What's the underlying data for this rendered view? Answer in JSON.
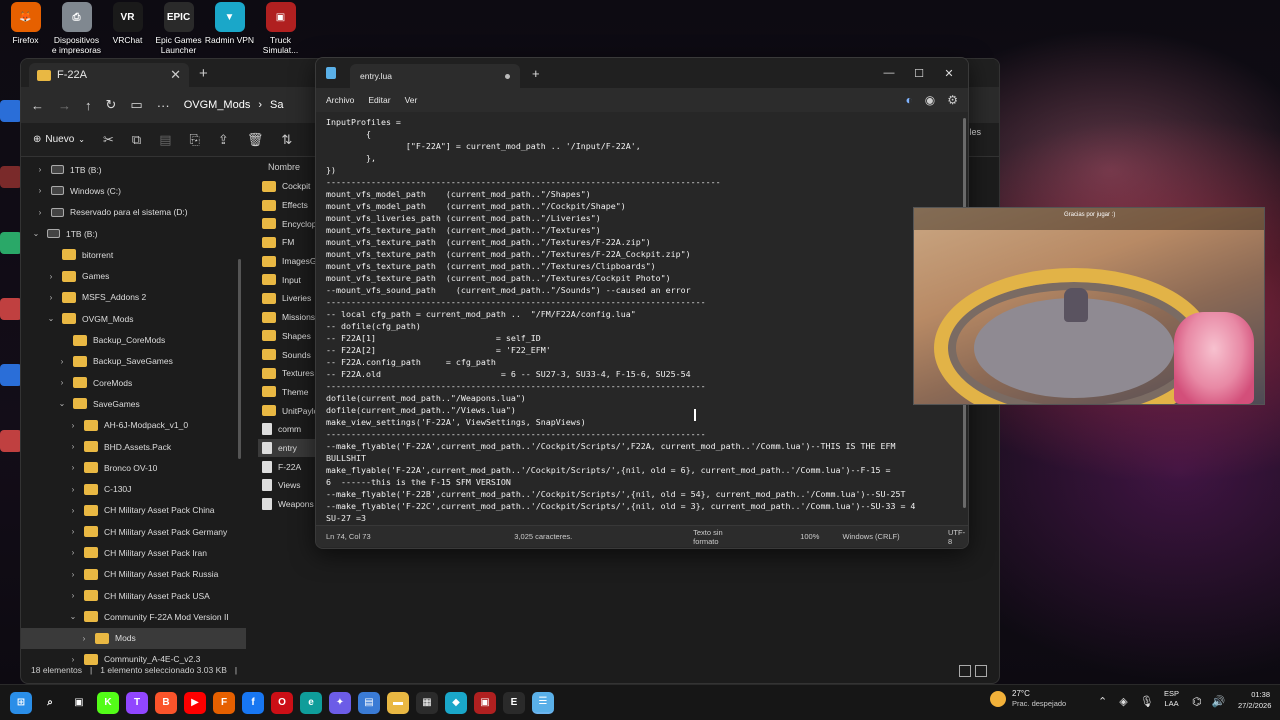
{
  "desktop_icons": [
    {
      "label": "Firefox",
      "color": "#e66000",
      "glyph": "🦊"
    },
    {
      "label": "Dispositivos e impresoras",
      "color": "#808890",
      "glyph": "⎙"
    },
    {
      "label": "VRChat",
      "color": "#1a1a1a",
      "glyph": "VR"
    },
    {
      "label": "Epic Games Launcher",
      "color": "#2a2a2a",
      "glyph": "EPIC"
    },
    {
      "label": "Radmin VPN",
      "color": "#1aa7c9",
      "glyph": "▼"
    },
    {
      "label": "Truck Simulat...",
      "color": "#b02020",
      "glyph": "▣"
    }
  ],
  "explorer": {
    "tab_title": "F-22A",
    "breadcrumb": [
      "OVGM_Mods",
      "Sa"
    ],
    "new_label": "Nuevo",
    "right_label": "talles",
    "tree": [
      {
        "label": "1TB (B:)",
        "type": "drive",
        "indent": 0,
        "chev": "›"
      },
      {
        "label": "Windows (C:)",
        "type": "drive",
        "indent": 0,
        "chev": "›"
      },
      {
        "label": "Reservado para el sistema (D:)",
        "type": "drive",
        "indent": 0,
        "chev": "›"
      },
      {
        "label": "1TB (B:)",
        "type": "drive",
        "indent": -1,
        "chev": "⌄"
      },
      {
        "label": "bitorrent",
        "type": "folder",
        "indent": 1,
        "chev": ""
      },
      {
        "label": "Games",
        "type": "folder",
        "indent": 1,
        "chev": "›"
      },
      {
        "label": "MSFS_Addons 2",
        "type": "folder",
        "indent": 1,
        "chev": "›"
      },
      {
        "label": "OVGM_Mods",
        "type": "folder",
        "indent": 1,
        "chev": "⌄"
      },
      {
        "label": "Backup_CoreMods",
        "type": "folder",
        "indent": 2,
        "chev": ""
      },
      {
        "label": "Backup_SaveGames",
        "type": "folder",
        "indent": 2,
        "chev": "›"
      },
      {
        "label": "CoreMods",
        "type": "folder",
        "indent": 2,
        "chev": "›"
      },
      {
        "label": "SaveGames",
        "type": "folder",
        "indent": 2,
        "chev": "⌄"
      },
      {
        "label": "AH-6J-Modpack_v1_0",
        "type": "folder",
        "indent": 3,
        "chev": "›"
      },
      {
        "label": "BHD.Assets.Pack",
        "type": "folder",
        "indent": 3,
        "chev": "›"
      },
      {
        "label": "Bronco OV-10",
        "type": "folder",
        "indent": 3,
        "chev": "›"
      },
      {
        "label": "C-130J",
        "type": "folder",
        "indent": 3,
        "chev": "›"
      },
      {
        "label": "CH Military Asset Pack China",
        "type": "folder",
        "indent": 3,
        "chev": "›"
      },
      {
        "label": "CH Military Asset Pack Germany",
        "type": "folder",
        "indent": 3,
        "chev": "›"
      },
      {
        "label": "CH Military Asset Pack Iran",
        "type": "folder",
        "indent": 3,
        "chev": "›"
      },
      {
        "label": "CH Military Asset Pack Russia",
        "type": "folder",
        "indent": 3,
        "chev": "›"
      },
      {
        "label": "CH Military Asset Pack USA",
        "type": "folder",
        "indent": 3,
        "chev": "›"
      },
      {
        "label": "Community F-22A Mod Version II",
        "type": "folder",
        "indent": 3,
        "chev": "⌄"
      },
      {
        "label": "Mods",
        "type": "folder",
        "indent": 4,
        "chev": "›",
        "selected": true
      },
      {
        "label": "Community_A-4E-C_v2.3",
        "type": "folder",
        "indent": 3,
        "chev": "›"
      }
    ],
    "files_header": "Nombre",
    "files": [
      {
        "label": "Cockpit",
        "type": "folder"
      },
      {
        "label": "Effects",
        "type": "folder"
      },
      {
        "label": "Encyclopedi",
        "type": "folder"
      },
      {
        "label": "FM",
        "type": "folder"
      },
      {
        "label": "ImagesGUI",
        "type": "folder"
      },
      {
        "label": "Input",
        "type": "folder"
      },
      {
        "label": "Liveries",
        "type": "folder"
      },
      {
        "label": "Missions",
        "type": "folder"
      },
      {
        "label": "Shapes",
        "type": "folder"
      },
      {
        "label": "Sounds",
        "type": "folder"
      },
      {
        "label": "Textures",
        "type": "folder"
      },
      {
        "label": "Theme",
        "type": "folder"
      },
      {
        "label": "UnitPayloads",
        "type": "folder"
      },
      {
        "label": "comm",
        "type": "file"
      },
      {
        "label": "entry",
        "type": "file",
        "selected": true
      },
      {
        "label": "F-22A",
        "type": "file"
      },
      {
        "label": "Views",
        "type": "file"
      },
      {
        "label": "Weapons",
        "type": "file"
      }
    ],
    "status_items": "18 elementos",
    "status_selected": "1 elemento seleccionado  3.03 KB"
  },
  "notepad": {
    "tab_title": "entry.lua",
    "menu": [
      "Archivo",
      "Editar",
      "Ver"
    ],
    "lines": [
      "InputProfiles =",
      "        {",
      "                [\"F-22A\"] = current_mod_path .. '/Input/F-22A',",
      "        },",
      "",
      "})",
      "-------------------------------------------------------------------------------",
      "mount_vfs_model_path    (current_mod_path..\"/Shapes\")",
      "mount_vfs_model_path    (current_mod_path..\"/Cockpit/Shape\")",
      "mount_vfs_liveries_path (current_mod_path..\"/Liveries\")",
      "mount_vfs_texture_path  (current_mod_path..\"/Textures\")",
      "mount_vfs_texture_path  (current_mod_path..\"/Textures/F-22A.zip\")",
      "mount_vfs_texture_path  (current_mod_path..\"/Textures/F-22A_Cockpit.zip\")",
      "mount_vfs_texture_path  (current_mod_path..\"/Textures/Clipboards\")",
      "mount_vfs_texture_path  (current_mod_path..\"/Textures/Cockpit Photo\")",
      "--mount_vfs_sound_path    (current_mod_path..\"/Sounds\") --caused an error",
      "----------------------------------------------------------------------------",
      "-- local cfg_path = current_mod_path ..  \"/FM/F22A/config.lua\"",
      "-- dofile(cfg_path)",
      "-- F22A[1]                        = self_ID",
      "-- F22A[2]                        = 'F22_EFM'",
      "-- F22A.config_path     = cfg_path",
      "-- F22A.old                        = 6 -- SU27-3, SU33-4, F-15-6, SU25-54",
      "----------------------------------------------------------------------------",
      "dofile(current_mod_path..\"/Weapons.lua\")",
      "dofile(current_mod_path..\"/Views.lua\")",
      "make_view_settings('F-22A', ViewSettings, SnapViews)",
      "----------------------------------------------------------------------------",
      "--make_flyable('F-22A',current_mod_path..'/Cockpit/Scripts/',F22A, current_mod_path..'/Comm.lua')--THIS IS THE EFM",
      "BULLSHIT",
      "make_flyable('F-22A',current_mod_path..'/Cockpit/Scripts/',{nil, old = 6}, current_mod_path..'/Comm.lua')--F-15 =",
      "6  ------this is the F-15 SFM VERSION",
      "--make_flyable('F-22B',current_mod_path..'/Cockpit/Scripts/',{nil, old = 54}, current_mod_path..'/Comm.lua')--SU-25T",
      "--make_flyable('F-22C',current_mod_path..'/Cockpit/Scripts/',{nil, old = 3}, current_mod_path..'/Comm.lua')--SU-33 = 4",
      "SU-27 =3"
    ],
    "status": {
      "position": "Ln 74, Col 73",
      "chars": "3,025 caracteres.",
      "format": "Texto sin formato",
      "zoom": "100%",
      "line_endings": "Windows (CRLF)",
      "encoding": "UTF-8"
    }
  },
  "stream": {
    "hud_text": "Gracias por jugar :)"
  },
  "taskbar": {
    "apps": [
      {
        "name": "start",
        "color": "#2a8ee8",
        "glyph": "⊞"
      },
      {
        "name": "search",
        "color": "#161616",
        "glyph": "⌕"
      },
      {
        "name": "taskview",
        "color": "#161616",
        "glyph": "▣"
      },
      {
        "name": "kick",
        "color": "#53fc18",
        "glyph": "K"
      },
      {
        "name": "twitch",
        "color": "#9146ff",
        "glyph": "T"
      },
      {
        "name": "brave",
        "color": "#fb542b",
        "glyph": "B"
      },
      {
        "name": "youtube",
        "color": "#ff0000",
        "glyph": "▶"
      },
      {
        "name": "firefox",
        "color": "#e66000",
        "glyph": "F"
      },
      {
        "name": "facebook",
        "color": "#1877f2",
        "glyph": "f"
      },
      {
        "name": "opera",
        "color": "#cc0f16",
        "glyph": "O"
      },
      {
        "name": "edge",
        "color": "#0f9d9a",
        "glyph": "e"
      },
      {
        "name": "copilot",
        "color": "#6c5ce7",
        "glyph": "✦"
      },
      {
        "name": "store",
        "color": "#3a7bd5",
        "glyph": "▤"
      },
      {
        "name": "explorer",
        "color": "#e9b843",
        "glyph": "▬"
      },
      {
        "name": "calendar",
        "color": "#2b2b2b",
        "glyph": "▦"
      },
      {
        "name": "vpn",
        "color": "#1aa7c9",
        "glyph": "◆"
      },
      {
        "name": "games",
        "color": "#b02020",
        "glyph": "▣"
      },
      {
        "name": "epic",
        "color": "#2a2a2a",
        "glyph": "E"
      },
      {
        "name": "notepad",
        "color": "#5ab0e8",
        "glyph": "☰",
        "active": true
      }
    ],
    "weather_temp": "27°C",
    "weather_desc": "Prac. despejado",
    "lang1": "ESP",
    "lang2": "LAA",
    "time": "01:38",
    "date": "27/2/2026"
  }
}
